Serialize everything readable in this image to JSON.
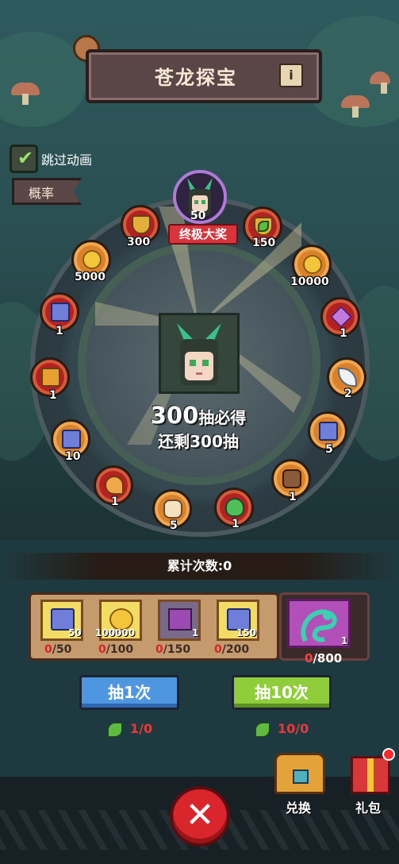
{
  "header": {
    "title": "苍龙探宝",
    "info_icon": "info-icon"
  },
  "options": {
    "skip_animation_label": "跳过动画",
    "skip_animation_checked": true,
    "probability_button": "概率"
  },
  "wheel": {
    "grand_prize": {
      "count": "50",
      "tag": "终极大奖"
    },
    "center": {
      "guarantee_number": "300",
      "guarantee_text": "抽必得",
      "remaining_text": "还剩300抽"
    },
    "items": [
      {
        "icon": "shield-icon",
        "count": "300"
      },
      {
        "icon": "coin-icon",
        "count": "5000"
      },
      {
        "icon": "card-icon",
        "count": "1"
      },
      {
        "icon": "ticket-icon",
        "count": "1"
      },
      {
        "icon": "card-icon",
        "count": "10"
      },
      {
        "icon": "claw-icon",
        "count": "1"
      },
      {
        "icon": "bread-icon",
        "count": "5"
      },
      {
        "icon": "potion-icon",
        "count": "1"
      },
      {
        "icon": "gem-bag-icon",
        "count": "1"
      },
      {
        "icon": "card-icon",
        "count": "5"
      },
      {
        "icon": "feather-icon",
        "count": "2"
      },
      {
        "icon": "crystal-icon",
        "count": "1"
      },
      {
        "icon": "coin-icon",
        "count": "10000"
      },
      {
        "icon": "shield-icon",
        "count": "150"
      }
    ]
  },
  "accumulate": {
    "label": "累计次数:0"
  },
  "milestones": [
    {
      "icon": "card-icon",
      "count": "50",
      "current": "0",
      "target": "/50"
    },
    {
      "icon": "coin-icon",
      "count": "100000",
      "current": "0",
      "target": "/100"
    },
    {
      "icon": "cat-chest-icon",
      "count": "1",
      "current": "0",
      "target": "/150"
    },
    {
      "icon": "card-icon",
      "count": "150",
      "current": "0",
      "target": "/200"
    }
  ],
  "final_reward": {
    "icon": "dragon-icon",
    "count": "1",
    "current": "0",
    "target": "/800"
  },
  "actions": {
    "draw1_label": "抽1次",
    "draw1_cost": "1/0",
    "draw10_label": "抽10次",
    "draw10_cost": "10/0"
  },
  "footer": {
    "exchange_label": "兑换",
    "gift_label": "礼包"
  },
  "colors": {
    "draw1": "#4e96e0",
    "draw10": "#8fce3a",
    "close": "#d8262c",
    "accent_red": "#d8343c"
  }
}
